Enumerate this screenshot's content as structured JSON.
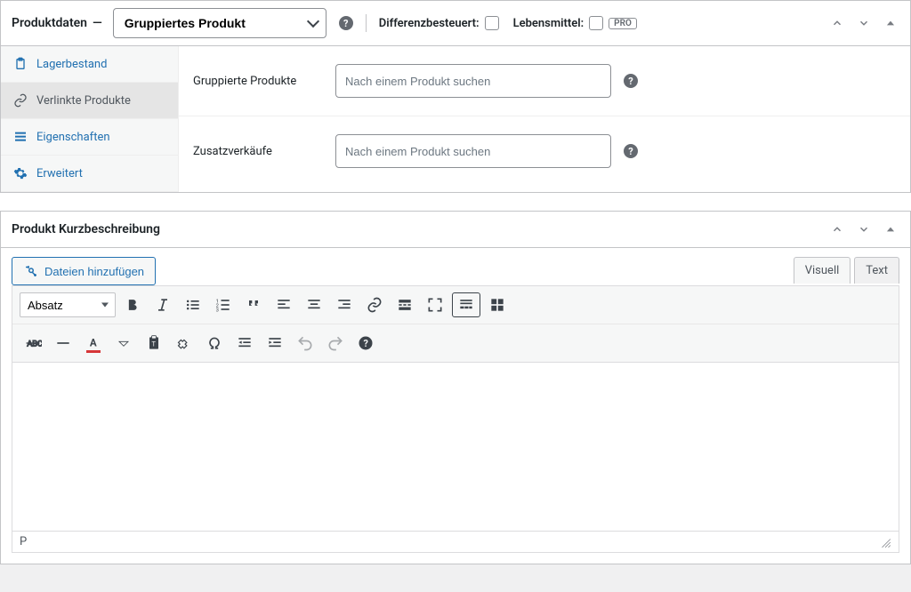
{
  "productData": {
    "title": "Produktdaten",
    "separator": "—",
    "typeSelected": "Gruppiertes Produkt",
    "differenzbesteuertLabel": "Differenzbesteuert:",
    "lebensmittelLabel": "Lebensmittel:",
    "proBadge": "PRO"
  },
  "tabs": {
    "inventory": "Lagerbestand",
    "linked": "Verlinkte Produkte",
    "attributes": "Eigenschaften",
    "advanced": "Erweitert"
  },
  "fields": {
    "grouped": {
      "label": "Gruppierte Produkte",
      "placeholder": "Nach einem Produkt suchen"
    },
    "upsell": {
      "label": "Zusatzverkäufe",
      "placeholder": "Nach einem Produkt suchen"
    }
  },
  "shortDesc": {
    "title": "Produkt Kurzbeschreibung",
    "addMedia": "Dateien hinzufügen",
    "visualTab": "Visuell",
    "textTab": "Text",
    "formatSelected": "Absatz",
    "statusPath": "P"
  }
}
